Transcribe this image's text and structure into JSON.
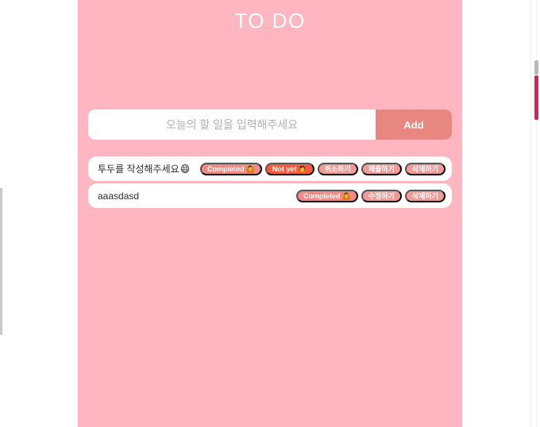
{
  "colors": {
    "panel_bg": "#ffb6c1",
    "accent": "#e88680",
    "chip_done": "#ef8a86",
    "chip_notyet": "#fb5b3c",
    "chip_action": "#f29a95",
    "card_bg": "#ffffff",
    "scrollbar_thumb": "#d2235b"
  },
  "app": {
    "title": "TO DO"
  },
  "composer": {
    "placeholder": "오늘의 할 일을 입력해주세요",
    "value": "",
    "add_label": "Add"
  },
  "todos": [
    {
      "text": "투두를 작성해주세요",
      "emoji": "😄",
      "chips": [
        {
          "label": "Completed",
          "emoji": "🙆",
          "kind": "status-done"
        },
        {
          "label": "Not yet",
          "emoji": "🙍",
          "kind": "status-notyet"
        },
        {
          "label": "취소하기",
          "emoji": "",
          "kind": "action"
        },
        {
          "label": "제출하기",
          "emoji": "",
          "kind": "action"
        },
        {
          "label": "삭제하기",
          "emoji": "",
          "kind": "action"
        }
      ]
    },
    {
      "text": "aaasdasd",
      "emoji": "",
      "chips": [
        {
          "label": "Completed",
          "emoji": "🙆",
          "kind": "status-done"
        },
        {
          "label": "수정하기",
          "emoji": "",
          "kind": "action"
        },
        {
          "label": "삭제하기",
          "emoji": "",
          "kind": "action"
        }
      ]
    }
  ]
}
